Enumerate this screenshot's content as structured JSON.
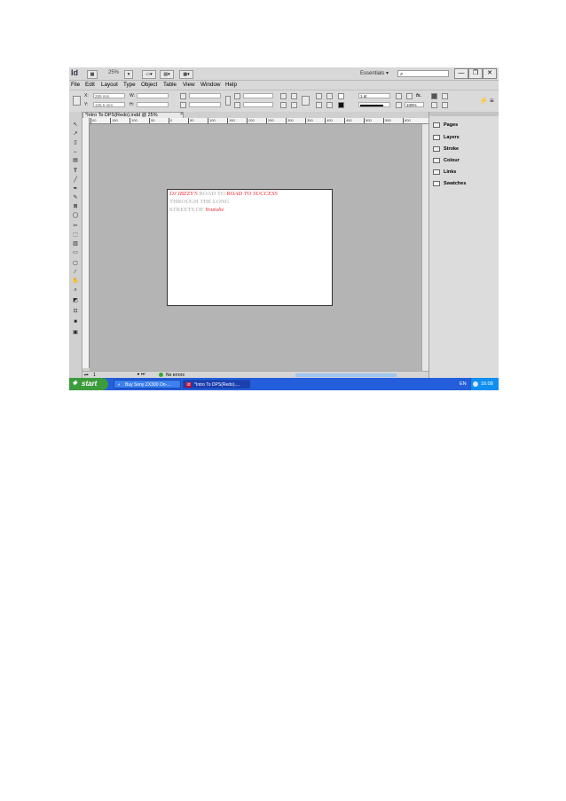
{
  "app": {
    "logo": "Id",
    "zoom": "25%",
    "workspace": "Essentials",
    "window_controls": [
      "—",
      "❐",
      "✕"
    ]
  },
  "menubar": [
    "File",
    "Edit",
    "Layout",
    "Type",
    "Object",
    "Table",
    "View",
    "Window",
    "Help"
  ],
  "control_panel": {
    "x_label": "X:",
    "y_label": "Y:",
    "x_value": "289 mm",
    "y_value": "106.5 mm",
    "w_label": "W:",
    "h_label": "H:",
    "stroke_weight": "1 pt",
    "opacity": "100%"
  },
  "document_tab": {
    "title": "*Intro To DPS(Redo).indd @ 25%",
    "close": "×"
  },
  "ruler_ticks": [
    "00",
    "150",
    "100",
    "50",
    "0",
    "50",
    "100",
    "150",
    "200",
    "250",
    "300",
    "350",
    "400",
    "450",
    "500",
    "550",
    "600"
  ],
  "page_text": {
    "line1_part1": "DJ IBZZY'S",
    "line1_part2": " ROAD TO ",
    "line1_part3": "ROAD TO SUCCESS",
    "line2": "THROUGH THE LONG",
    "line3_part1": "STREETS OF ",
    "line3_part2": "Youtube"
  },
  "panels": [
    "Pages",
    "Layers",
    "Stroke",
    "Colour",
    "Links",
    "Swatches"
  ],
  "status_bar": {
    "page": "1",
    "preflight": "No errors"
  },
  "taskbar": {
    "start": "start",
    "tasks": [
      {
        "label": "Buy Sony ZX300 On-..."
      },
      {
        "label": "*Intro To DPS(Redo)...."
      }
    ],
    "language": "EN",
    "clock": "16:08"
  },
  "colors": {
    "accent_red": "#e8323c",
    "taskbar_blue": "#245edb",
    "start_green": "#3c9b3c"
  }
}
